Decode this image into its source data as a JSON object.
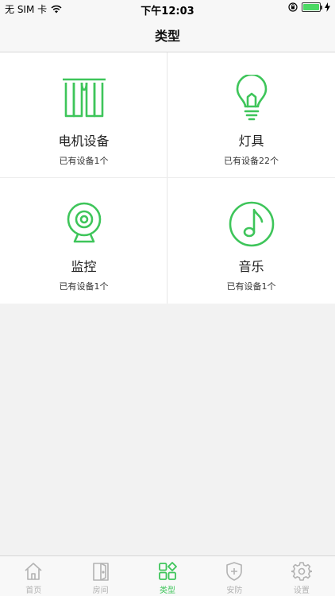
{
  "status_bar": {
    "carrier": "无 SIM 卡",
    "time": "下午12:03"
  },
  "nav": {
    "title": "类型"
  },
  "accent_color": "#3ec55a",
  "categories": [
    {
      "name": "电机设备",
      "count_text": "已有设备1个",
      "icon": "curtain-icon"
    },
    {
      "name": "灯具",
      "count_text": "已有设备22个",
      "icon": "bulb-icon"
    },
    {
      "name": "监控",
      "count_text": "已有设备1个",
      "icon": "camera-icon"
    },
    {
      "name": "音乐",
      "count_text": "已有设备1个",
      "icon": "music-note-icon"
    }
  ],
  "tabs": [
    {
      "label": "首页",
      "icon": "home-icon",
      "active": false
    },
    {
      "label": "房间",
      "icon": "door-icon",
      "active": false
    },
    {
      "label": "类型",
      "icon": "grid-icon",
      "active": true
    },
    {
      "label": "安防",
      "icon": "shield-icon",
      "active": false
    },
    {
      "label": "设置",
      "icon": "gear-icon",
      "active": false
    }
  ]
}
